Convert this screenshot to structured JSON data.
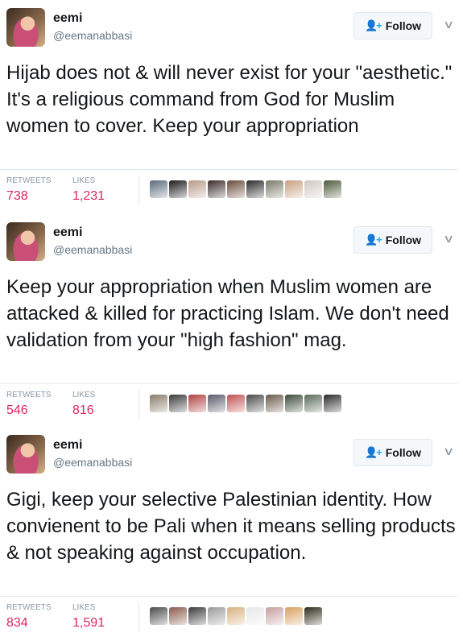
{
  "tweets": [
    {
      "name": "eemi",
      "handle": "@eemanabbasi",
      "follow_label": "Follow",
      "text": "Hijab does not & will never exist for your \"aesthetic.\" It's a religious command from God for Muslim women to cover. Keep your appropriation",
      "retweets_label": "RETWEETS",
      "retweets": "738",
      "likes_label": "LIKES",
      "likes": "1,231",
      "liker_colors": [
        "#5a6a7a",
        "#1a1a1a",
        "#b89a8a",
        "#3a2a2a",
        "#6a4a3a",
        "#2a2a2a",
        "#7a7a6a",
        "#c8a080",
        "#d0c8c0",
        "#4a5a3a"
      ]
    },
    {
      "name": "eemi",
      "handle": "@eemanabbasi",
      "follow_label": "Follow",
      "text": "Keep your appropriation when Muslim women are attacked & killed for practicing Islam. We don't need validation from your \"high fashion\" mag.",
      "retweets_label": "RETWEETS",
      "retweets": "546",
      "likes_label": "LIKES",
      "likes": "816",
      "liker_colors": [
        "#8a7a6a",
        "#3a3a3a",
        "#b04040",
        "#5a5a6a",
        "#c05050",
        "#4a4a4a",
        "#6a5a4a",
        "#3a4a3a",
        "#5a6a5a",
        "#2a2a2a"
      ]
    },
    {
      "name": "eemi",
      "handle": "@eemanabbasi",
      "follow_label": "Follow",
      "text": "Gigi, keep your selective Palestinian identity. How convienent to be Pali when it means selling products & not speaking against occupation.",
      "retweets_label": "RETWEETS",
      "retweets": "834",
      "likes_label": "LIKES",
      "likes": "1,591",
      "liker_colors": [
        "#4a4a4a",
        "#8a5a4a",
        "#3a3a3a",
        "#9a9a9a",
        "#d8b080",
        "#e8e8e8",
        "#c8a0a0",
        "#d8a060",
        "#2a2a1a"
      ]
    }
  ]
}
